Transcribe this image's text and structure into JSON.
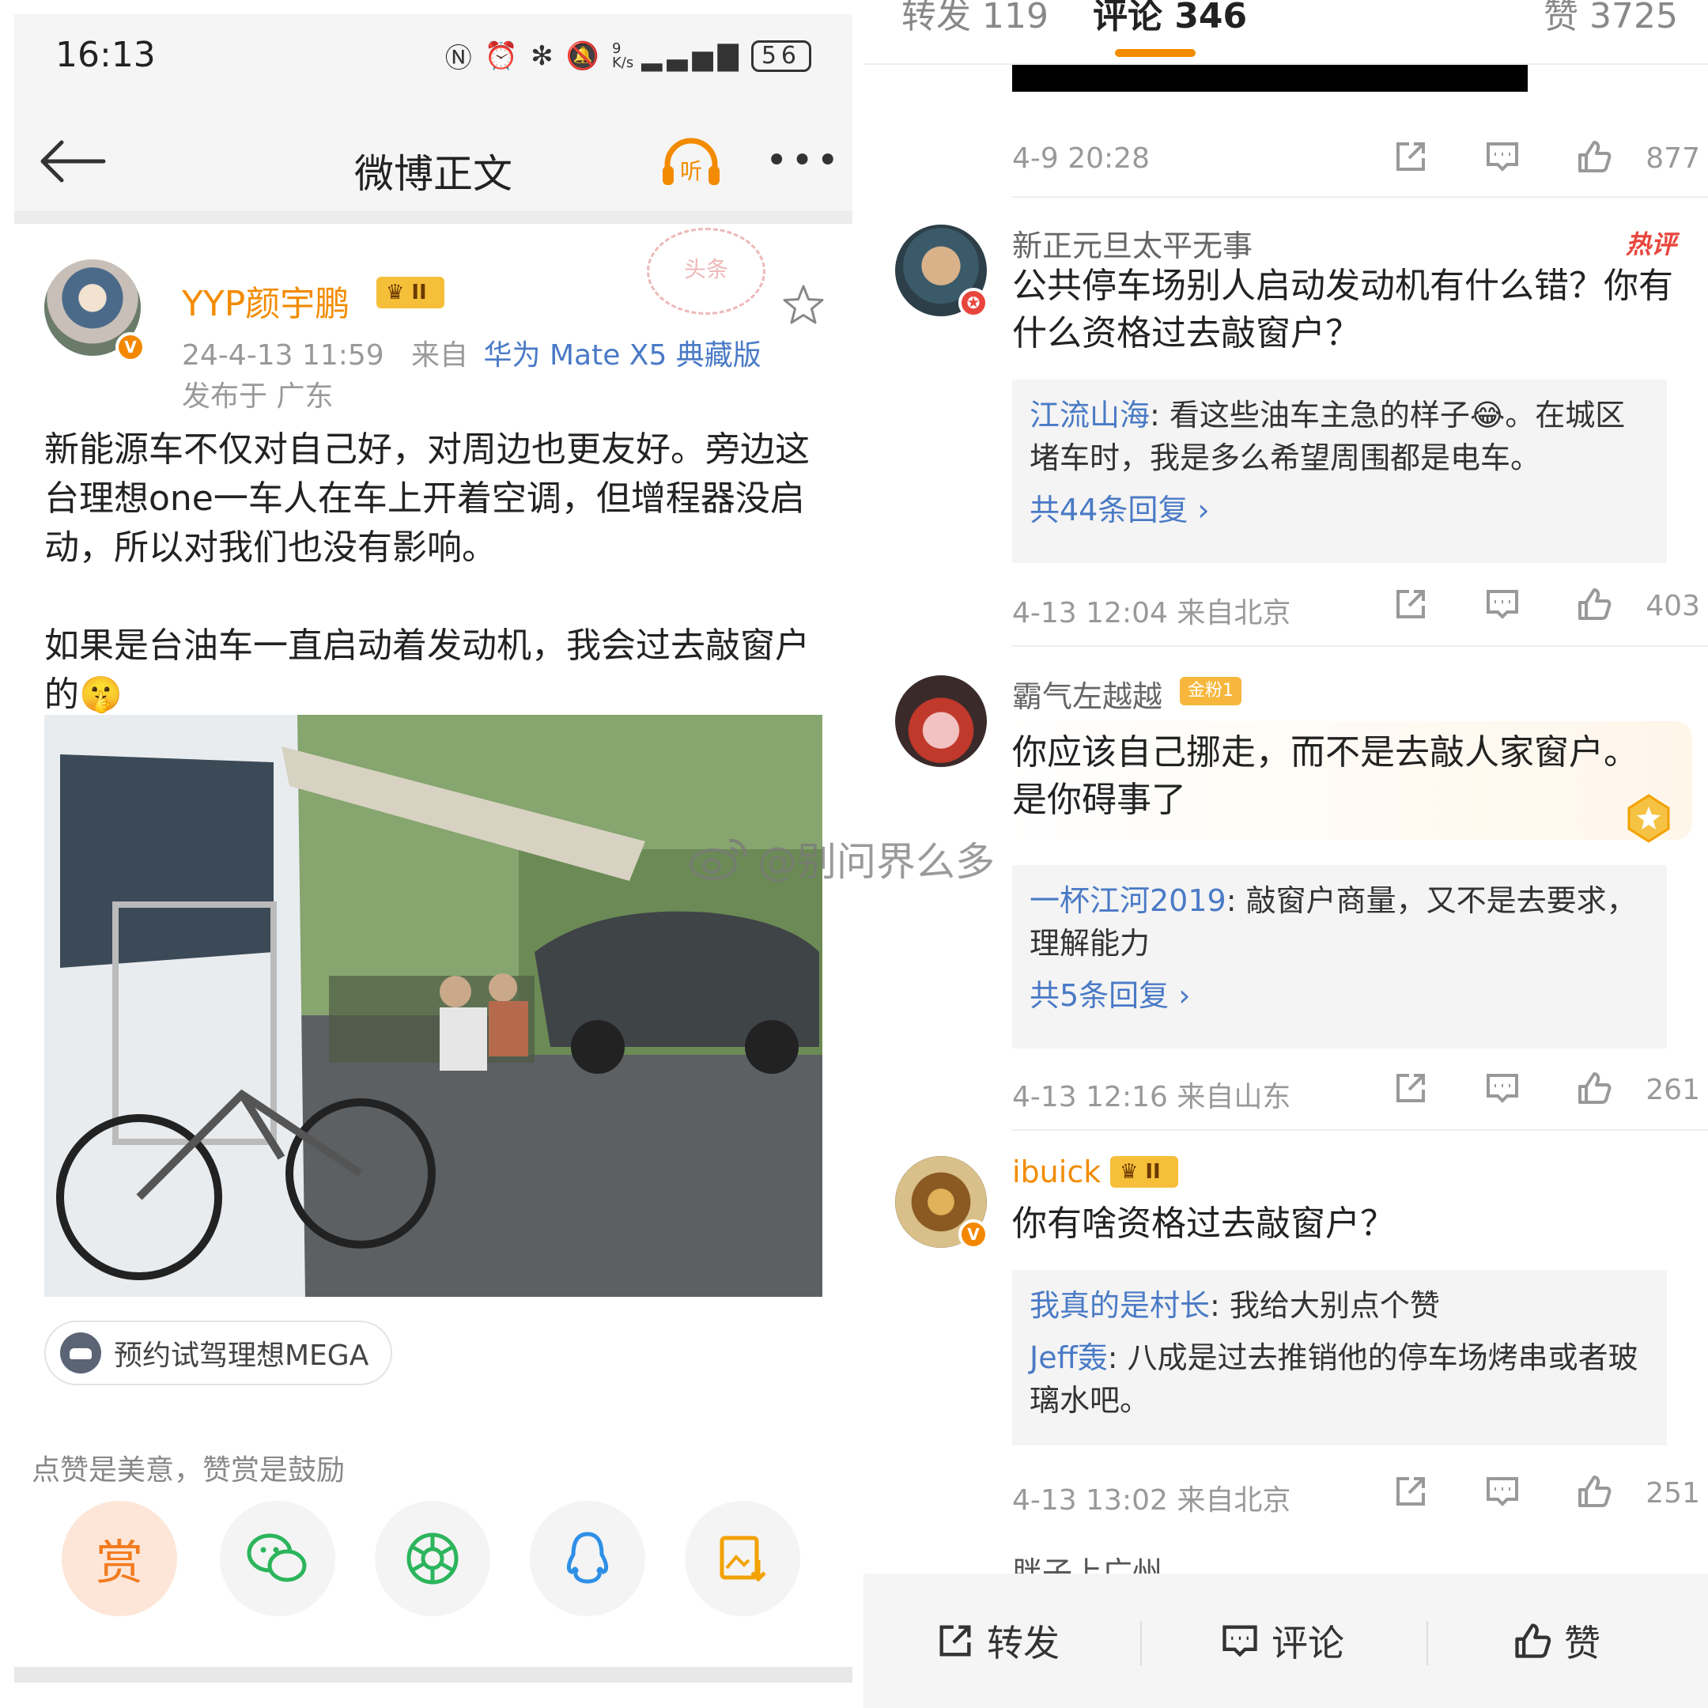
{
  "left": {
    "status": {
      "time": "16:13",
      "net_speed": "9\nK/s",
      "battery": "56"
    },
    "nav": {
      "title": "微博正文",
      "listen_label": "听"
    },
    "author": {
      "name": "YYP颜宇鹏",
      "rank": "II",
      "date": "24-4-13 11:59",
      "from_prefix": "来自",
      "device": "华为 Mate X5 典藏版",
      "location": "发布于 广东",
      "stamp": "头条"
    },
    "post": {
      "paragraph1": "新能源车不仅对自己好，对周边也更友好。旁边这台理想one一车人在车上开着空调，但增程器没启动，所以对我们也没有影响。",
      "paragraph2": "如果是台油车一直启动着发动机，我会过去敲窗户的🤫"
    },
    "ad_pill": "预约试驾理想MEGA",
    "tip": "点赞是美意，赞赏是鼓励",
    "share": {
      "reward_label": "赏"
    }
  },
  "right": {
    "tabs": [
      {
        "label": "转发 119"
      },
      {
        "label": "评论 346"
      },
      {
        "label": "赞 3725"
      }
    ],
    "first_meta": {
      "when": "4-9 20:28",
      "likes": "877"
    },
    "comments": [
      {
        "user": "新正元旦太平无事",
        "hot": "热评",
        "text": "公共停车场别人启动发动机有什么错？你有什么资格过去敲窗户？",
        "replies": [
          {
            "name": "江流山海",
            "text": ": 看这些油车主急的样子😂。在城区堵车时，我是多么希望周围都是电车。"
          }
        ],
        "more": "共44条回复 ›",
        "when": "4-13 12:04  来自北京",
        "likes": "403"
      },
      {
        "user": "霸气左越越",
        "badge": "金粉1",
        "text": "你应该自己挪走，而不是去敲人家窗户。是你碍事了",
        "replies": [
          {
            "name": "一杯江河2019",
            "text": ": 敲窗户商量，又不是去要求，理解能力"
          }
        ],
        "more": "共5条回复 ›",
        "when": "4-13 12:16  来自山东",
        "likes": "261"
      },
      {
        "user": "ibuick",
        "rank": "II",
        "text": "你有啥资格过去敲窗户？",
        "replies": [
          {
            "name": "我真的是村长",
            "text": ": 我给大别点个赞"
          },
          {
            "name": "Jeff轰",
            "text": ": 八成是过去推销他的停车场烤串或者玻璃水吧。"
          }
        ],
        "when": "4-13 13:02  来自北京",
        "likes": "251"
      }
    ],
    "peek_user": "胖子上广州",
    "watermark": "@别问界么多",
    "bottom": {
      "repost": "转发",
      "comment": "评论",
      "like": "赞"
    }
  }
}
